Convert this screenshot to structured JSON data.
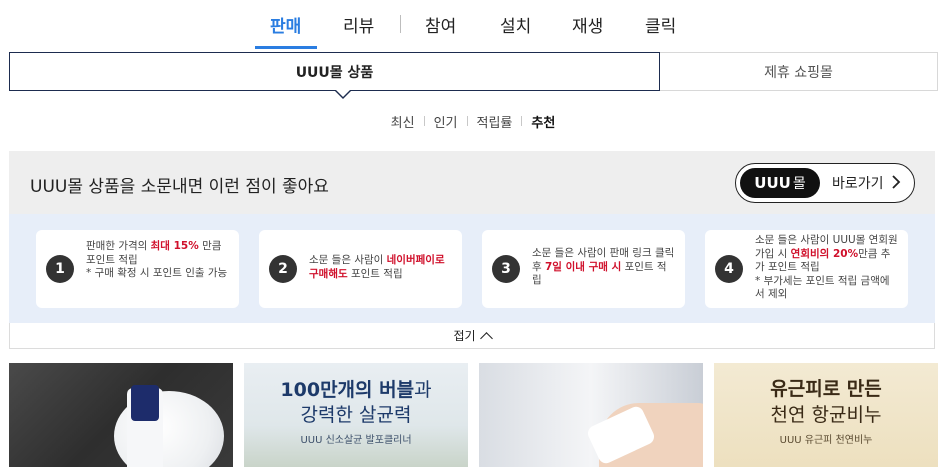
{
  "main_tabs": [
    {
      "label": "판매",
      "active": true
    },
    {
      "label": "리뷰",
      "active": false
    },
    {
      "label": "참여",
      "active": false
    },
    {
      "label": "설치",
      "active": false
    },
    {
      "label": "재생",
      "active": false
    },
    {
      "label": "클릭",
      "active": false
    }
  ],
  "sub_tabs": {
    "own": "UUU몰 상품",
    "partner": "제휴 쇼핑몰"
  },
  "sort": {
    "items": [
      "최신",
      "인기",
      "적립률",
      "추천"
    ],
    "active": "추천"
  },
  "promo": {
    "title": "UUU몰 상품을 소문내면 이런 점이 좋아요",
    "button": {
      "logo": "UUU",
      "logo_suffix": "몰",
      "label": "바로가기",
      "arrow": "›"
    },
    "cards": [
      {
        "num": "1",
        "pre": "판매한 가격의 ",
        "highlight": "최대 15%",
        "post": " 만큼 포인트 적립",
        "note": "* 구매 확정 시 포인트 인출 가능"
      },
      {
        "num": "2",
        "pre": "소문 들은 사람이 ",
        "highlight": "네이버페이로 구매해도",
        "post": " 포인트 적립",
        "note": ""
      },
      {
        "num": "3",
        "pre": "소문 들은 사람이 판매 링크 클릭 후 ",
        "highlight": "7일 이내 구매 시",
        "post": " 포인트 적립",
        "note": ""
      },
      {
        "num": "4",
        "pre": "소문 들은 사람이 UUU몰 연회원 가입 시 ",
        "highlight": "연회비의 20%",
        "post": "만큼 추가 포인트 적립",
        "note": "* 부가세는 포인트 적립 금액에서 제외"
      }
    ],
    "fold_label": "접기"
  },
  "products": [
    {
      "name": "foam-cleanser-bottle"
    },
    {
      "headline_bold": "100만개의 버블",
      "headline_light": "과",
      "headline2": "강력한 살균력",
      "sub": "UUU 신소살균 발포클리너"
    },
    {
      "name": "hand-holding-tube"
    },
    {
      "headline": "유근피로 만든",
      "headline2": "천연 항균비누",
      "sub": "UUU 유근피 천연비누"
    }
  ],
  "colors": {
    "accent": "#2a7de1",
    "highlight_red": "#d0102b",
    "panel_bg": "#e7eef9",
    "header_bg": "#eeeeee"
  }
}
